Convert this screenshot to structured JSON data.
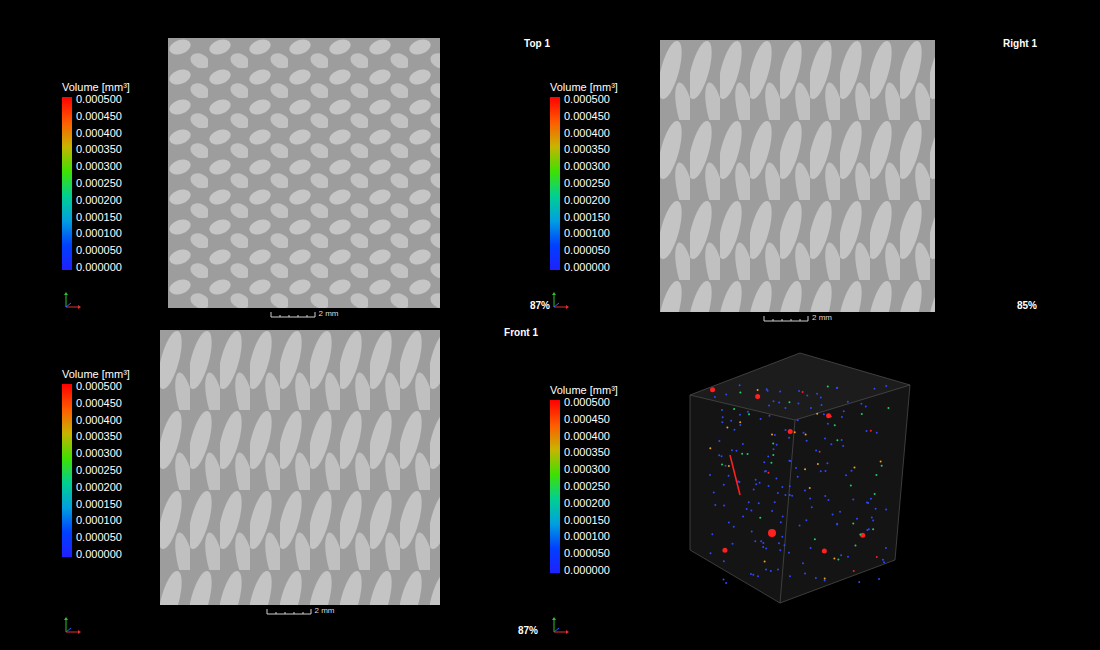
{
  "panels": [
    {
      "title": "Top 1",
      "kind": "slice",
      "zoom": "87%",
      "scale_bar": "2 mm",
      "legend": {
        "title": "Volume [mm³]",
        "ticks": [
          "0.000500",
          "0.000450",
          "0.000400",
          "0.000350",
          "0.000300",
          "0.000250",
          "0.000200",
          "0.000150",
          "0.000100",
          "0.000050",
          "0.000000"
        ]
      }
    },
    {
      "title": "Right 1",
      "kind": "slice",
      "zoom": "85%",
      "scale_bar": "2 mm",
      "legend": {
        "title": "Volume [mm³]",
        "ticks": [
          "0.000500",
          "0.000450",
          "0.000400",
          "0.000350",
          "0.000300",
          "0.000250",
          "0.000200",
          "0.000150",
          "0.000100",
          "0.000050",
          "0.000000"
        ]
      }
    },
    {
      "title": "Front 1",
      "kind": "slice",
      "zoom": "87%",
      "scale_bar": "2 mm",
      "legend": {
        "title": "Volume [mm³]",
        "ticks": [
          "0.000500",
          "0.000450",
          "0.000400",
          "0.000350",
          "0.000300",
          "0.000250",
          "0.000200",
          "0.000150",
          "0.000100",
          "0.000050",
          "0.000000"
        ]
      }
    },
    {
      "kind": "3d",
      "legend": {
        "title": "Volume [mm³]",
        "ticks": [
          "0.000500",
          "0.000450",
          "0.000400",
          "0.000350",
          "0.000300",
          "0.000250",
          "0.000200",
          "0.000150",
          "0.000100",
          "0.000050",
          "0.000000"
        ]
      }
    }
  ]
}
